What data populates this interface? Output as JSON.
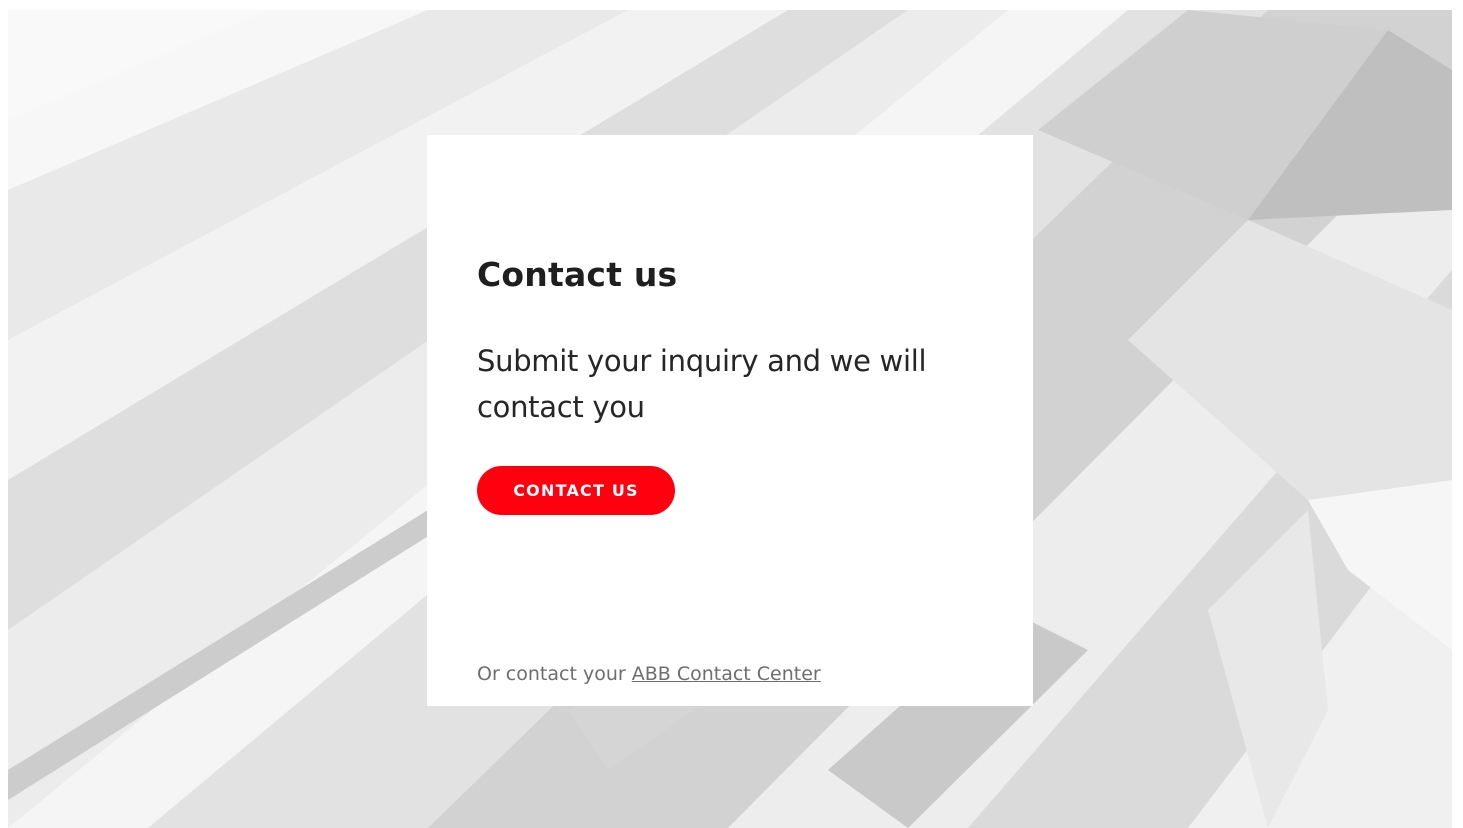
{
  "colors": {
    "accent": "#ff000f",
    "card_bg": "#ffffff",
    "title_text": "#1f1f1f",
    "muted_text": "#6e6e6e"
  },
  "background": {
    "image": "grey-crystal-polygon-pattern"
  },
  "card": {
    "title": "Contact us",
    "description": "Submit your inquiry and we will contact you",
    "button_label": "CONTACT US",
    "footer_prefix": "Or contact your ",
    "footer_link": "ABB Contact Center"
  }
}
